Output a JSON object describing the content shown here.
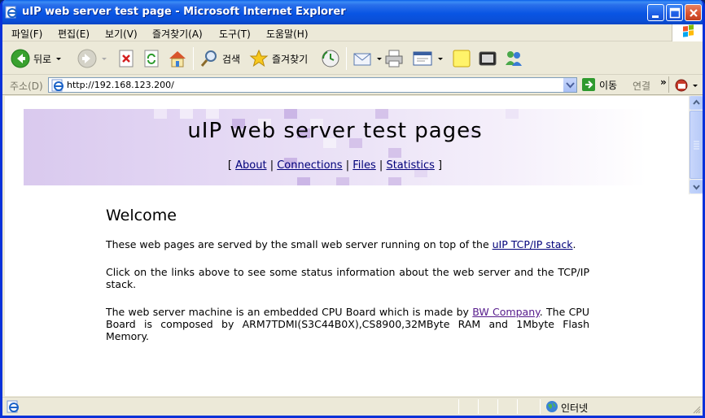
{
  "window": {
    "title": "uIP web server test page - Microsoft Internet Explorer"
  },
  "menu": {
    "items": [
      {
        "label": "파일(F)"
      },
      {
        "label": "편집(E)"
      },
      {
        "label": "보기(V)"
      },
      {
        "label": "즐겨찾기(A)"
      },
      {
        "label": "도구(T)"
      },
      {
        "label": "도움말(H)"
      }
    ]
  },
  "toolbar": {
    "back_label": "뒤로",
    "search_label": "검색",
    "favorites_label": "즐겨찾기"
  },
  "address": {
    "label": "주소(D)",
    "url": "http://192.168.123.200/",
    "go_label": "이동",
    "links_label": "연결"
  },
  "page": {
    "banner_title": "uIP web server test pages",
    "nav": {
      "open": "[",
      "close": "]",
      "separator": "|",
      "links": [
        "About",
        "Connections",
        "Files",
        "Statistics"
      ]
    },
    "heading": "Welcome",
    "p1_before": "These web pages are served by the small web server running on top of the ",
    "p1_link": "uIP TCP/IP stack",
    "p1_after": ".",
    "p2": "Click on the links above to see some status information about the web server and the TCP/IP stack.",
    "p3_before": "The web server machine is an embedded CPU Board which is made by ",
    "p3_link": "BW Company",
    "p3_after": ". The CPU Board is composed by ARM7TDMI(S3C44B0X),CS8900,32MByte RAM and 1Mbyte Flash Memory."
  },
  "status": {
    "zone": "인터넷"
  },
  "colors": {
    "title_bar": "#0a55e4",
    "link": "#00007a",
    "visited_link": "#551a8b",
    "banner_purple": "#d9c9ee"
  }
}
